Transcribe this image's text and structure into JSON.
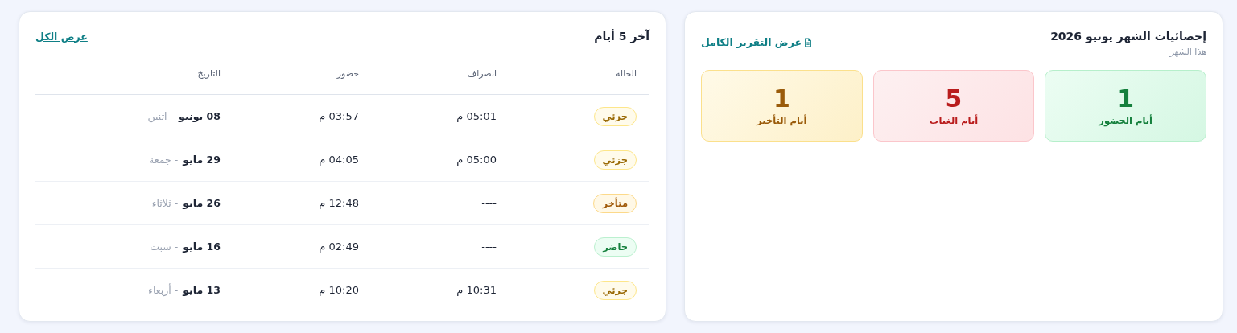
{
  "stats": {
    "title": "إحصائيات الشهر يونيو 2026",
    "subtitle": "هذا الشهر",
    "link": "عرض التقرير الكامل",
    "cards": [
      {
        "kind": "present",
        "value": "1",
        "label": "أيام الحضور"
      },
      {
        "kind": "absent",
        "value": "5",
        "label": "أيام الغياب"
      },
      {
        "kind": "late",
        "value": "1",
        "label": "أيام التأخير"
      }
    ]
  },
  "recent": {
    "title": "آخر 5 أيام",
    "link": "عرض الكل",
    "columns": [
      "الحالة",
      "انصراف",
      "حضور",
      "التاريخ"
    ],
    "rows": [
      {
        "status": "جزئي",
        "kind": "partial",
        "checkout": "05:01 م",
        "checkin": "03:57 م",
        "date": "08 يونيو",
        "weekday": "- اثنين"
      },
      {
        "status": "جزئي",
        "kind": "partial",
        "checkout": "05:00 م",
        "checkin": "04:05 م",
        "date": "29 مايو",
        "weekday": "- جمعة"
      },
      {
        "status": "متأخر",
        "kind": "late",
        "checkout": "----",
        "checkin": "12:48 م",
        "date": "26 مايو",
        "weekday": "- ثلاثاء"
      },
      {
        "status": "حاضر",
        "kind": "present",
        "checkout": "----",
        "checkin": "02:49 م",
        "date": "16 مايو",
        "weekday": "- سبت"
      },
      {
        "status": "جزئي",
        "kind": "partial",
        "checkout": "10:31 م",
        "checkin": "10:20 م",
        "date": "13 مايو",
        "weekday": "- أربعاء"
      }
    ]
  }
}
